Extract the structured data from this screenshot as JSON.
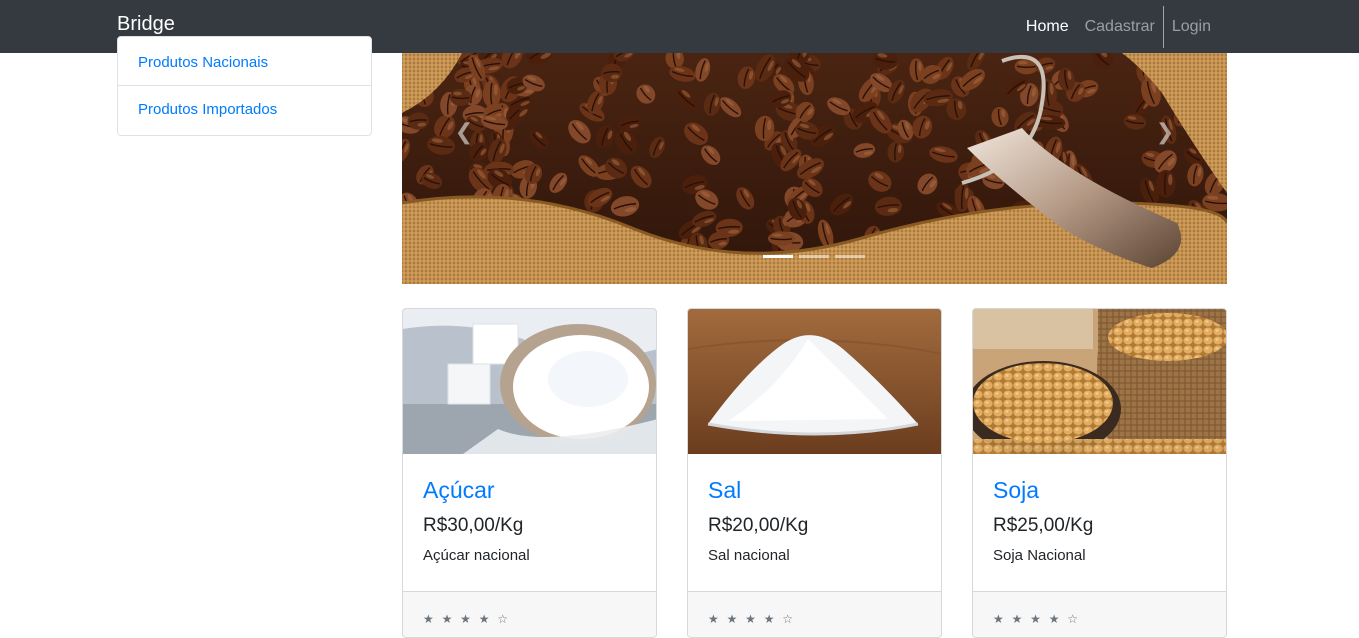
{
  "navbar": {
    "brand": "Bridge",
    "links": [
      {
        "label": "Home",
        "active": true
      },
      {
        "label": "Cadastrar",
        "active": false
      },
      {
        "label": "Login",
        "active": false
      }
    ]
  },
  "sidebar": {
    "items": [
      {
        "label": "Produtos Nacionais"
      },
      {
        "label": "Produtos Importados"
      }
    ]
  },
  "carousel": {
    "prev_icon": "chevron-left-icon",
    "next_icon": "chevron-right-icon",
    "slide_count": 3,
    "active_slide": 1
  },
  "products": [
    {
      "name": "Açúcar",
      "price": "R$30,00/Kg",
      "description": "Açúcar nacional",
      "stars": "★ ★ ★ ★ ☆",
      "rating": 4
    },
    {
      "name": "Sal",
      "price": "R$20,00/Kg",
      "description": "Sal nacional",
      "stars": "★ ★ ★ ★ ☆",
      "rating": 4
    },
    {
      "name": "Soja",
      "price": "R$25,00/Kg",
      "description": "Soja Nacional",
      "stars": "★ ★ ★ ★ ☆",
      "rating": 4
    }
  ],
  "colors": {
    "navbar": "#343a40",
    "link": "#007bff",
    "coffee": "#5a2e16",
    "burlap": "#c9964f"
  }
}
